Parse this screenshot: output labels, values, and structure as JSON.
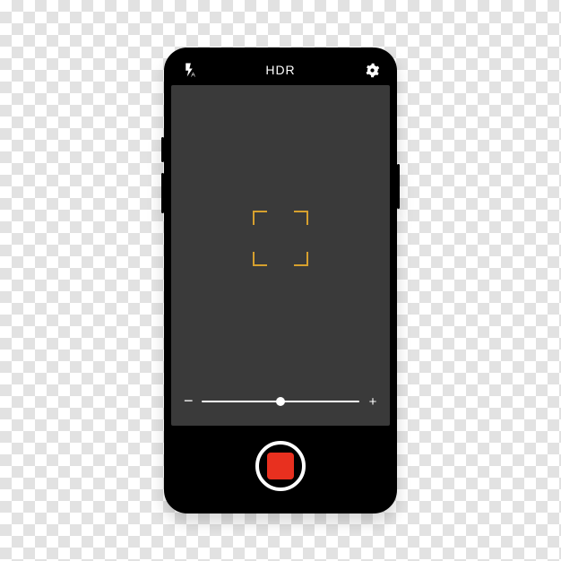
{
  "topbar": {
    "flash_mode": "A",
    "hdr_label": "HDR"
  },
  "zoom": {
    "minus": "−",
    "plus": "+",
    "value_percent": 50
  },
  "colors": {
    "focus_frame": "#d6a02e",
    "viewfinder_bg": "#3a3a3a",
    "record": "#e8301f"
  },
  "icons": {
    "flash": "flash-auto-icon",
    "settings": "gear-icon",
    "record": "record-stop-icon"
  }
}
